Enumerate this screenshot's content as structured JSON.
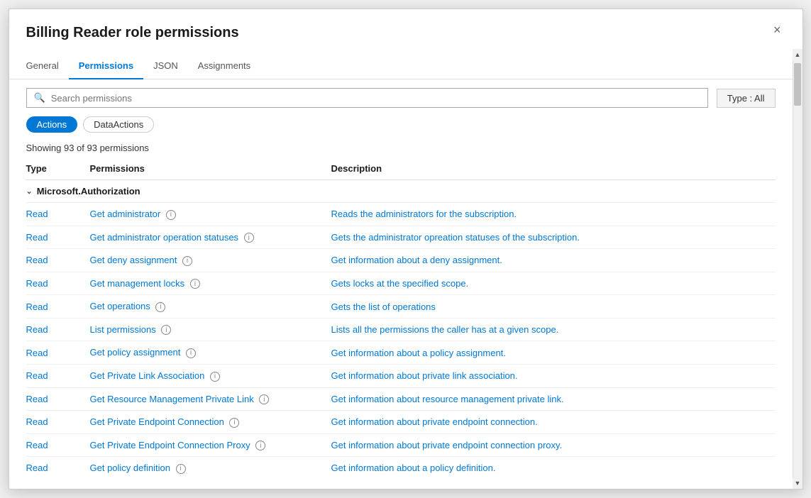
{
  "modal": {
    "title": "Billing Reader role permissions",
    "close_label": "×"
  },
  "tabs": [
    {
      "id": "general",
      "label": "General",
      "active": false
    },
    {
      "id": "permissions",
      "label": "Permissions",
      "active": true
    },
    {
      "id": "json",
      "label": "JSON",
      "active": false
    },
    {
      "id": "assignments",
      "label": "Assignments",
      "active": false
    }
  ],
  "search": {
    "placeholder": "Search permissions"
  },
  "type_filter": {
    "label": "Type : All"
  },
  "filter_buttons": [
    {
      "id": "actions",
      "label": "Actions",
      "active": true
    },
    {
      "id": "dataactions",
      "label": "DataActions",
      "active": false
    }
  ],
  "count_text": "Showing 93 of 93 permissions",
  "table": {
    "headers": [
      "Type",
      "Permissions",
      "Description"
    ],
    "groups": [
      {
        "name": "Microsoft.Authorization",
        "rows": [
          {
            "type": "Read",
            "permission": "Get administrator",
            "description": "Reads the administrators for the subscription."
          },
          {
            "type": "Read",
            "permission": "Get administrator operation statuses",
            "description": "Gets the administrator opreation statuses of the subscription."
          },
          {
            "type": "Read",
            "permission": "Get deny assignment",
            "description": "Get information about a deny assignment."
          },
          {
            "type": "Read",
            "permission": "Get management locks",
            "description": "Gets locks at the specified scope."
          },
          {
            "type": "Read",
            "permission": "Get operations",
            "description": "Gets the list of operations"
          },
          {
            "type": "Read",
            "permission": "List permissions",
            "description": "Lists all the permissions the caller has at a given scope."
          },
          {
            "type": "Read",
            "permission": "Get policy assignment",
            "description": "Get information about a policy assignment."
          },
          {
            "type": "Read",
            "permission": "Get Private Link Association",
            "description": "Get information about private link association."
          },
          {
            "type": "Read",
            "permission": "Get Resource Management Private Link",
            "description": "Get information about resource management private link."
          },
          {
            "type": "Read",
            "permission": "Get Private Endpoint Connection",
            "description": "Get information about private endpoint connection."
          },
          {
            "type": "Read",
            "permission": "Get Private Endpoint Connection Proxy",
            "description": "Get information about private endpoint connection proxy."
          },
          {
            "type": "Read",
            "permission": "Get policy definition",
            "description": "Get information about a policy definition."
          }
        ]
      }
    ]
  }
}
